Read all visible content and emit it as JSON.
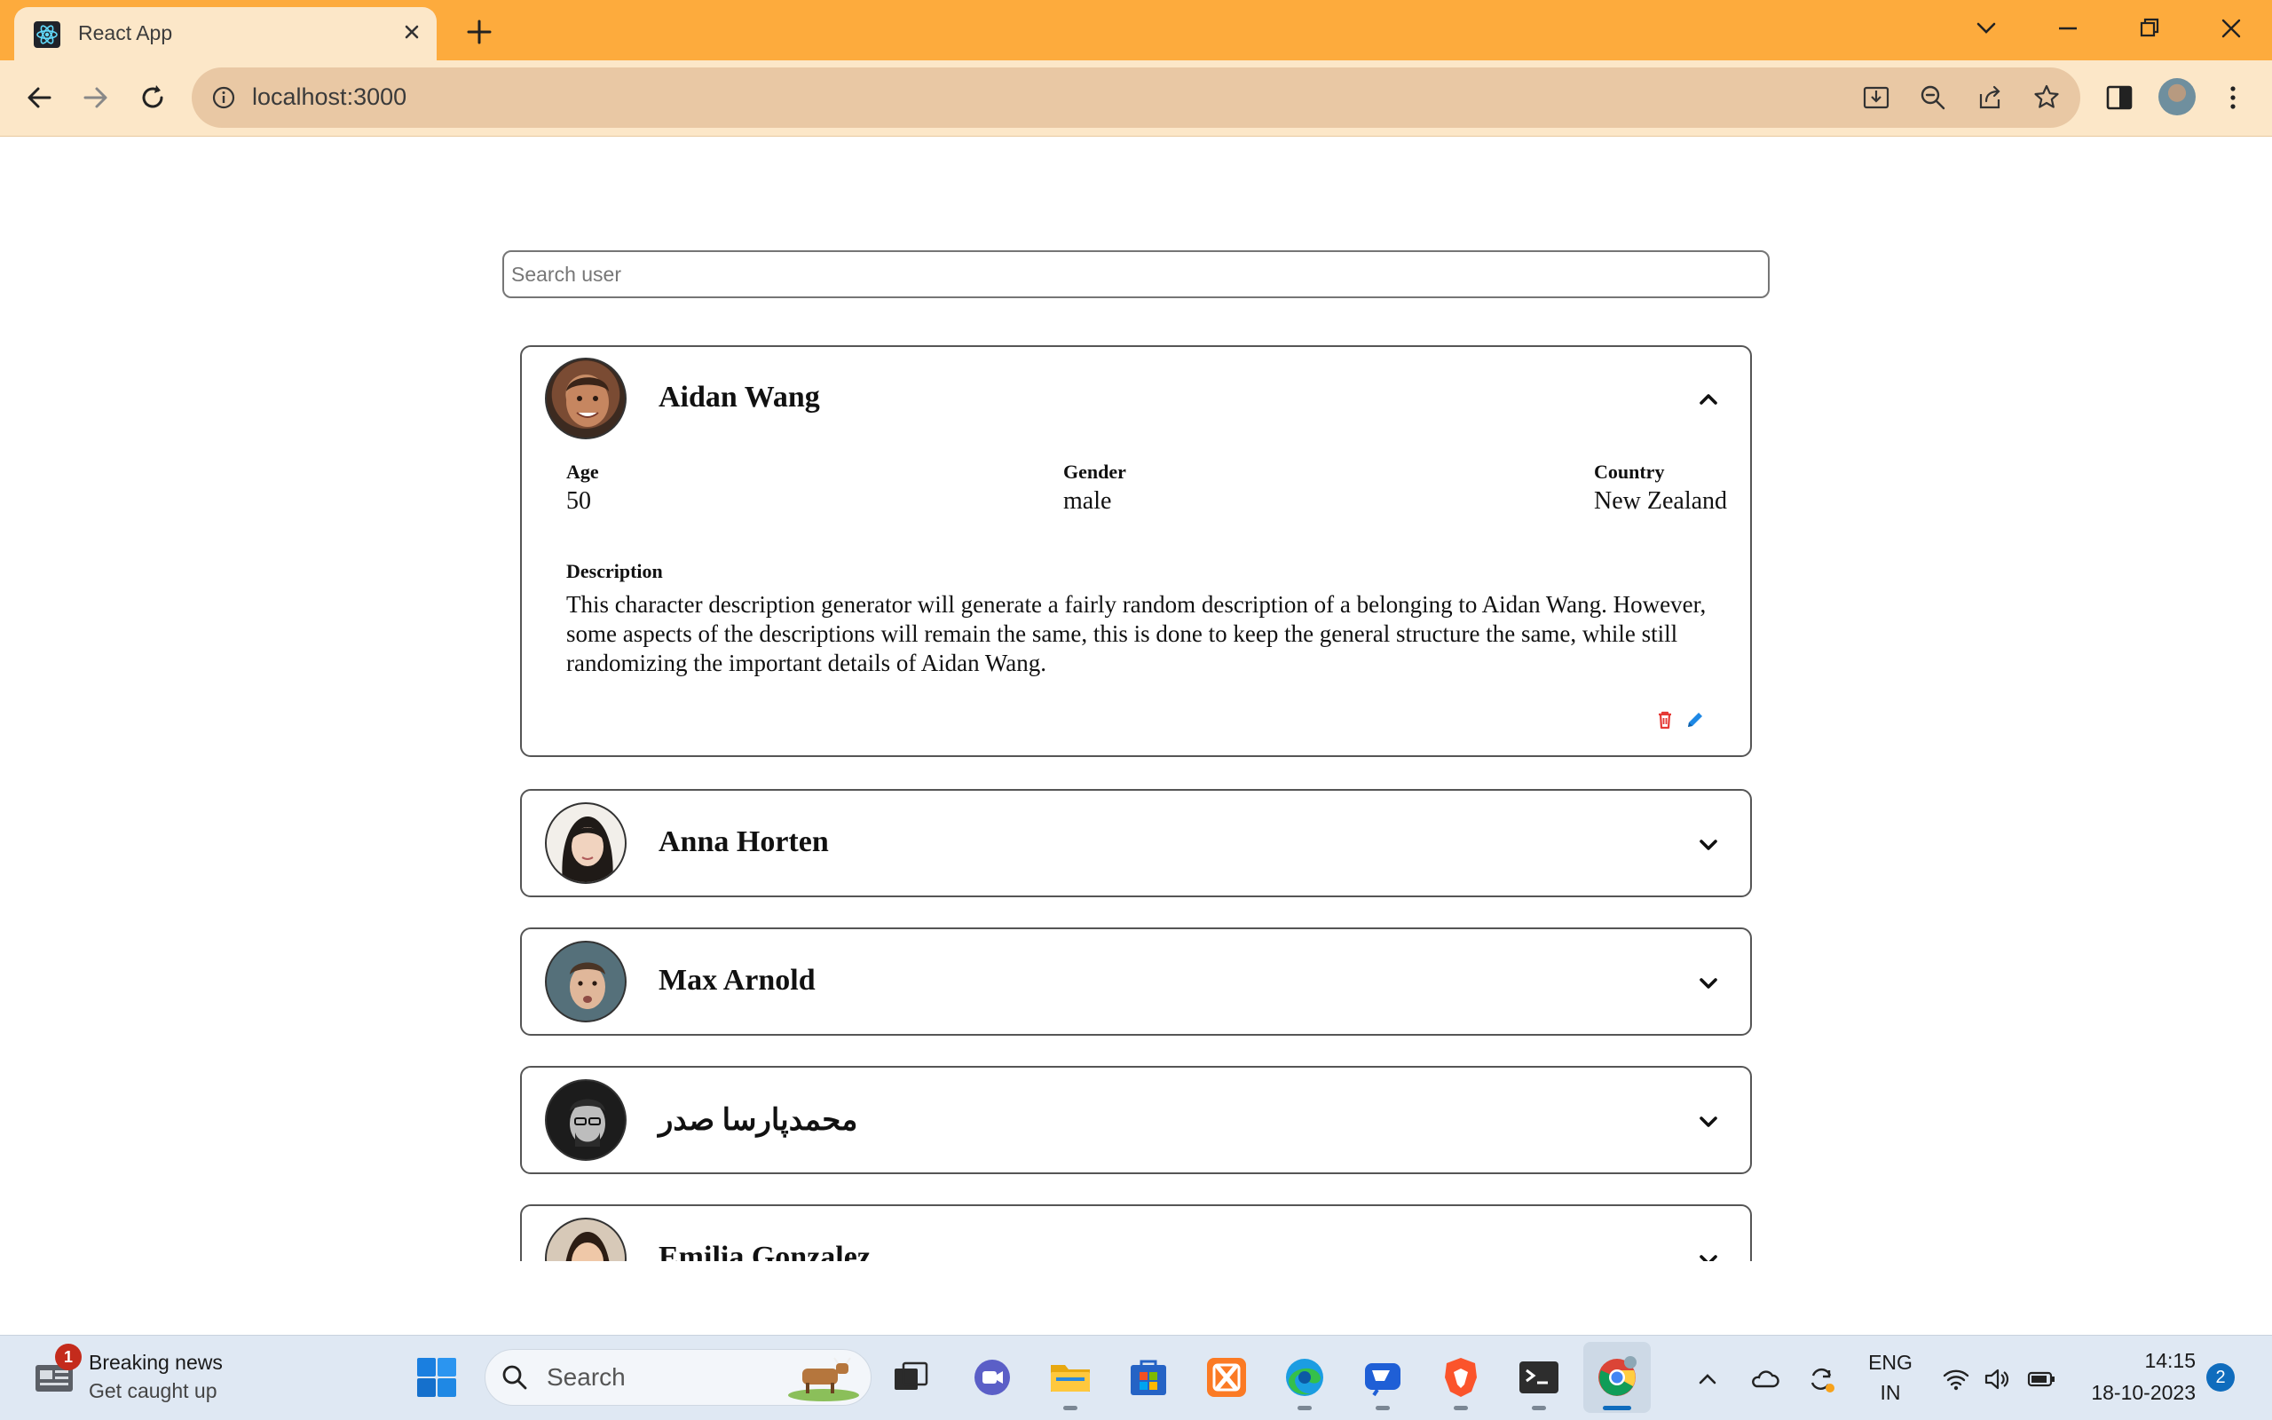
{
  "browser": {
    "tab_title": "React App",
    "url": "localhost:3000"
  },
  "search": {
    "placeholder": "Search user",
    "value": ""
  },
  "users": [
    {
      "name": "Aidan Wang",
      "expanded": true,
      "age_label": "Age",
      "age": "50",
      "gender_label": "Gender",
      "gender": "male",
      "country_label": "Country",
      "country": "New Zealand",
      "description_label": "Description",
      "description": "This character description generator will generate a fairly random description of a belonging to Aidan Wang. However, some aspects of the descriptions will remain the same, this is done to keep the general structure the same, while still randomizing the important details of Aidan Wang."
    },
    {
      "name": "Anna Horten",
      "expanded": false
    },
    {
      "name": "Max Arnold",
      "expanded": false
    },
    {
      "name": "محمدپارسا صدر",
      "expanded": false
    },
    {
      "name": "Emilia Gonzalez",
      "expanded": false
    }
  ],
  "colors": {
    "delete_icon": "#e53935",
    "edit_icon": "#1e88e5",
    "tab_bar": "#fdab3d",
    "toolbar": "#fce7c8"
  },
  "taskbar": {
    "news_badge": "1",
    "news_title": "Breaking news",
    "news_subtitle": "Get caught up",
    "search_label": "Search",
    "lang_top": "ENG",
    "lang_bottom": "IN",
    "time": "14:15",
    "date": "18-10-2023",
    "notification_count": "2"
  }
}
